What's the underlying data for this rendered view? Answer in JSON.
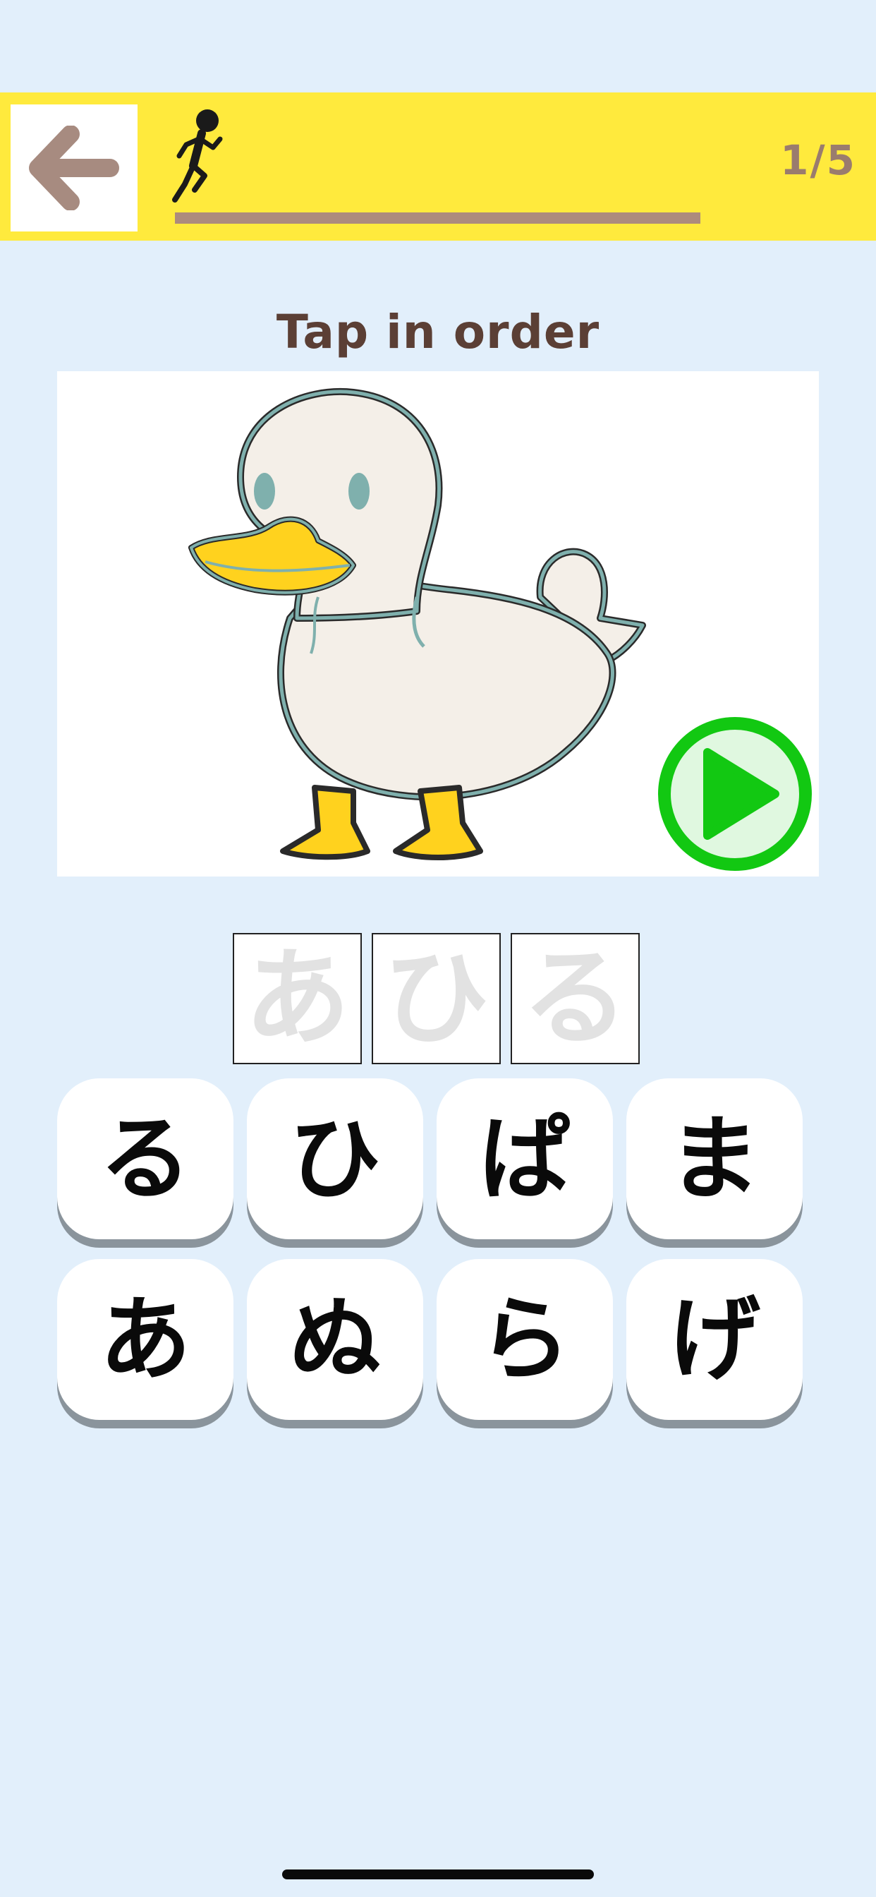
{
  "header": {
    "back_icon": "arrow-left-icon",
    "runner_icon": "running-person-icon",
    "progress": {
      "current": 1,
      "total": 5,
      "label": "1/5"
    }
  },
  "quiz": {
    "instruction": "Tap in order",
    "image": "duck-illustration",
    "play_icon": "play-icon",
    "slots": [
      {
        "char": "あ"
      },
      {
        "char": "ひ"
      },
      {
        "char": "る"
      }
    ],
    "tiles": [
      {
        "char": "る"
      },
      {
        "char": "ひ"
      },
      {
        "char": "ぱ"
      },
      {
        "char": "ま"
      },
      {
        "char": "あ"
      },
      {
        "char": "ぬ"
      },
      {
        "char": "ら"
      },
      {
        "char": "げ"
      }
    ]
  },
  "colors": {
    "background": "#e2effb",
    "header": "#ffea3d",
    "accent_brown": "#9a7c6e",
    "play_green": "#12c812"
  }
}
